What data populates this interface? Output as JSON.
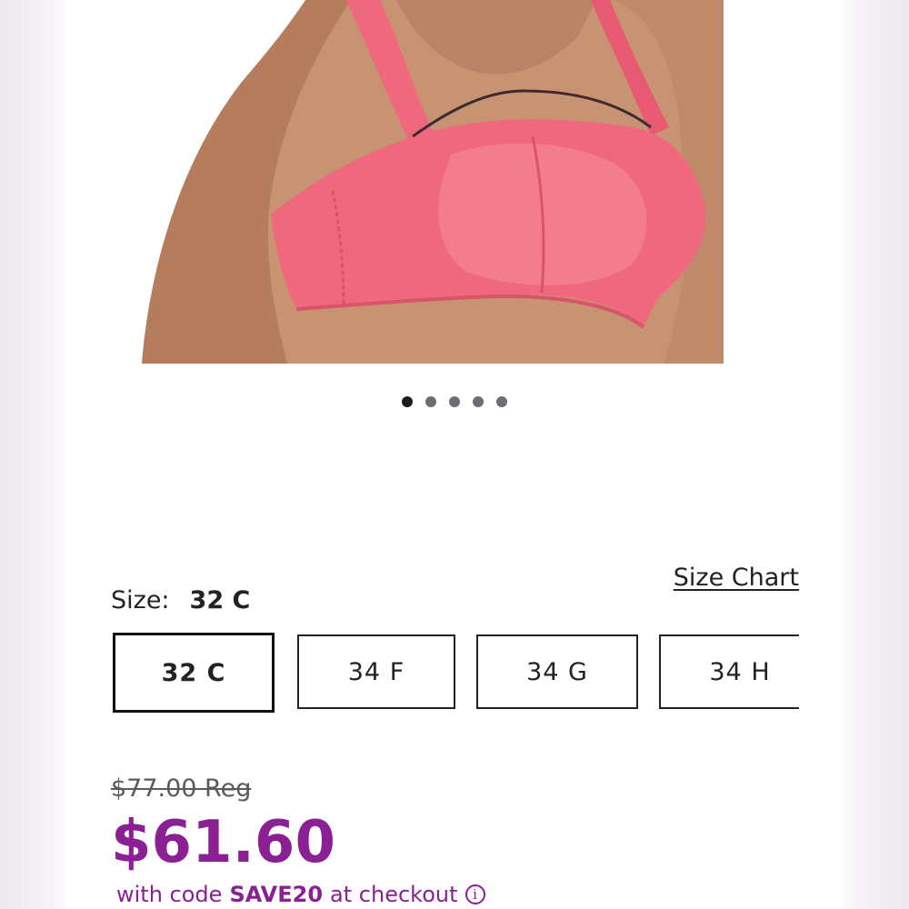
{
  "product": {
    "image_alt": "pink sports bra product image",
    "carousel": {
      "count": 5,
      "active_index": 0
    }
  },
  "size": {
    "label": "Size:",
    "selected_value": "32 C",
    "chart_link": "Size Chart",
    "options": [
      "32 C",
      "34 F",
      "34 G",
      "34 H"
    ]
  },
  "price": {
    "regular": "$77.00 Reg",
    "sale": "$61.60",
    "promo_prefix": "with code",
    "promo_code": "SAVE20",
    "promo_suffix": "at checkout",
    "info_glyph": "i"
  },
  "colors": {
    "accent": "#8b1f94",
    "product_pink": "#f0687e"
  }
}
